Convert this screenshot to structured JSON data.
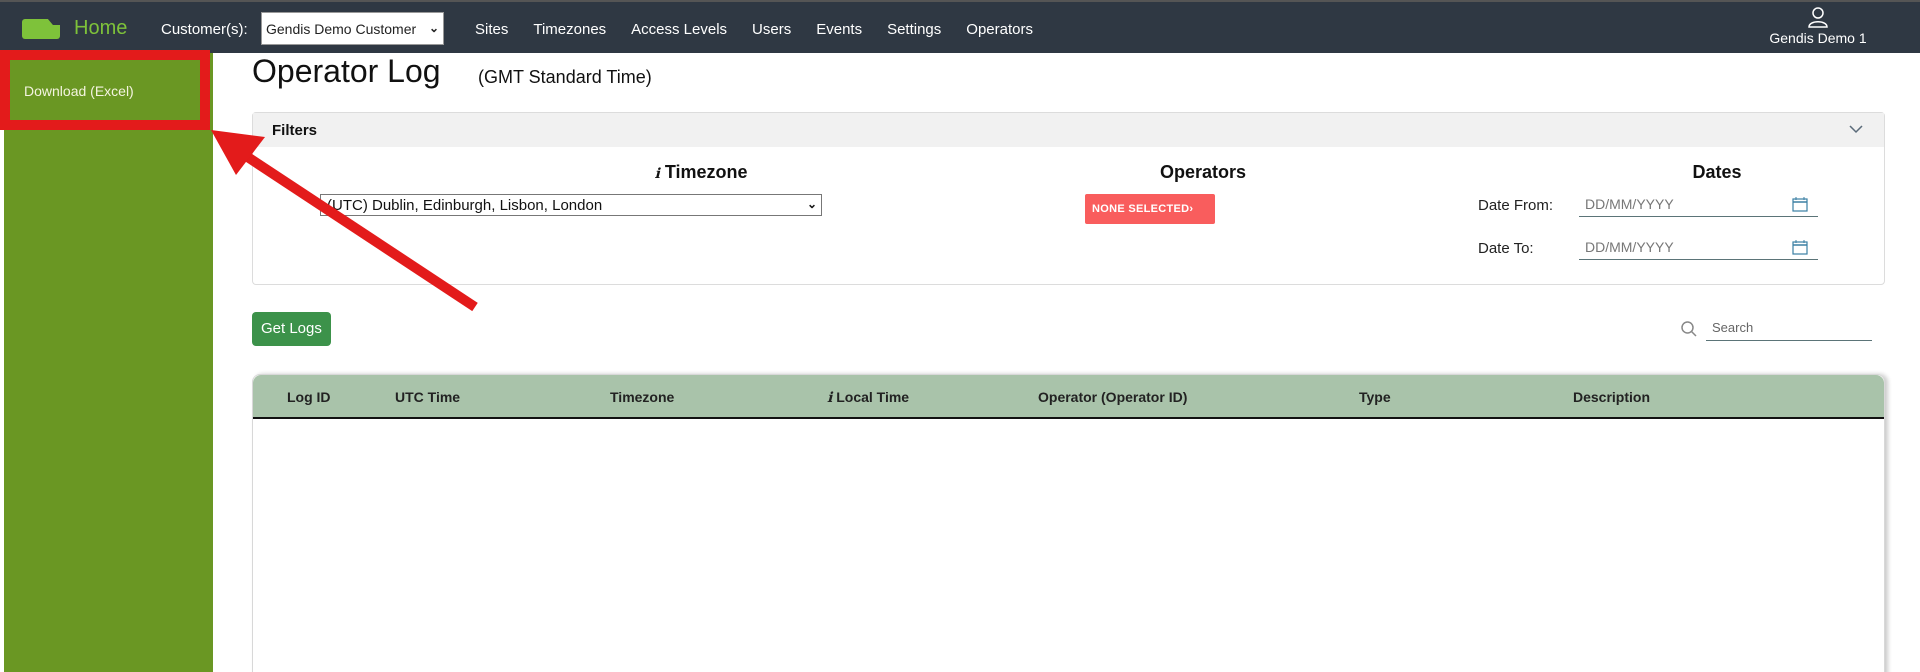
{
  "topbar": {
    "logo_icon": "folder-logo-icon",
    "home_label": "Home",
    "customer_label": "Customer(s):",
    "customer_selected": "Gendis Demo Customer",
    "nav_items": [
      "Sites",
      "Timezones",
      "Access Levels",
      "Users",
      "Events",
      "Settings",
      "Operators"
    ],
    "user_icon": "user-icon",
    "user_name": "Gendis Demo 1"
  },
  "sidebar": {
    "items": [
      {
        "label": "Download (Excel)"
      }
    ]
  },
  "main": {
    "title": "Operator Log",
    "subtitle": "(GMT Standard Time)",
    "filters": {
      "header": "Filters",
      "timezone": {
        "title": "Timezone",
        "info_icon": "info-icon",
        "selected": "(UTC) Dublin, Edinburgh, Lisbon, London"
      },
      "operators": {
        "title": "Operators",
        "button_label": "NONE SELECTED›"
      },
      "dates": {
        "title": "Dates",
        "from_label": "Date From:",
        "from_placeholder": "DD/MM/YYYY",
        "to_label": "Date To:",
        "to_placeholder": "DD/MM/YYYY"
      }
    },
    "get_logs_label": "Get Logs",
    "search_placeholder": "Search",
    "table": {
      "columns": [
        "Log ID",
        "UTC Time",
        "Timezone",
        "Local Time",
        "Operator (Operator ID)",
        "Type",
        "Description"
      ],
      "rows": []
    }
  },
  "annotation": {
    "color": "#e31b1b",
    "target": "Download (Excel)"
  },
  "colors": {
    "topbar": "#2f3843",
    "brand_green": "#7ec23a",
    "sidebar_green": "#6a9723",
    "table_header": "#a9c3aa",
    "get_logs_button": "#3c924a",
    "none_selected_button": "#f95d5d"
  }
}
